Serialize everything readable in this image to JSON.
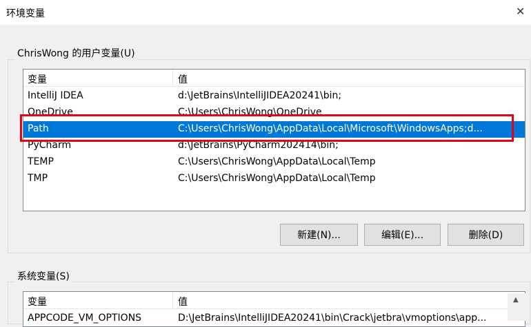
{
  "window": {
    "title": "环境变量",
    "close_glyph": "✕"
  },
  "user_vars": {
    "group_label": "ChrisWong 的用户变量(U)",
    "col_var": "变量",
    "col_val": "值",
    "rows": [
      {
        "name": "IntelliJ IDEA",
        "value": "d:\\JetBrains\\IntelliJIDEA20241\\bin;"
      },
      {
        "name": "OneDrive",
        "value": "C:\\Users\\ChrisWong\\OneDrive"
      },
      {
        "name": "Path",
        "value": "C:\\Users\\ChrisWong\\AppData\\Local\\Microsoft\\WindowsApps;d..."
      },
      {
        "name": "PyCharm",
        "value": "d:\\JetBrains\\PyCharm202414\\bin;"
      },
      {
        "name": "TEMP",
        "value": "C:\\Users\\ChrisWong\\AppData\\Local\\Temp"
      },
      {
        "name": "TMP",
        "value": "C:\\Users\\ChrisWong\\AppData\\Local\\Temp"
      }
    ],
    "selected_index": 2,
    "buttons": {
      "new": "新建(N)...",
      "edit": "编辑(E)...",
      "delete": "删除(D)"
    }
  },
  "system_vars": {
    "group_label": "系统变量(S)",
    "col_var": "变量",
    "col_val": "值",
    "rows": [
      {
        "name": "APPCODE_VM_OPTIONS",
        "value": "D:\\JetBrains\\IntelliJIDEA20241\\bin\\Crack\\jetbra\\vmoptions\\app..."
      }
    ]
  },
  "colors": {
    "selection": "#0078d7",
    "annotation": "#e60012"
  }
}
